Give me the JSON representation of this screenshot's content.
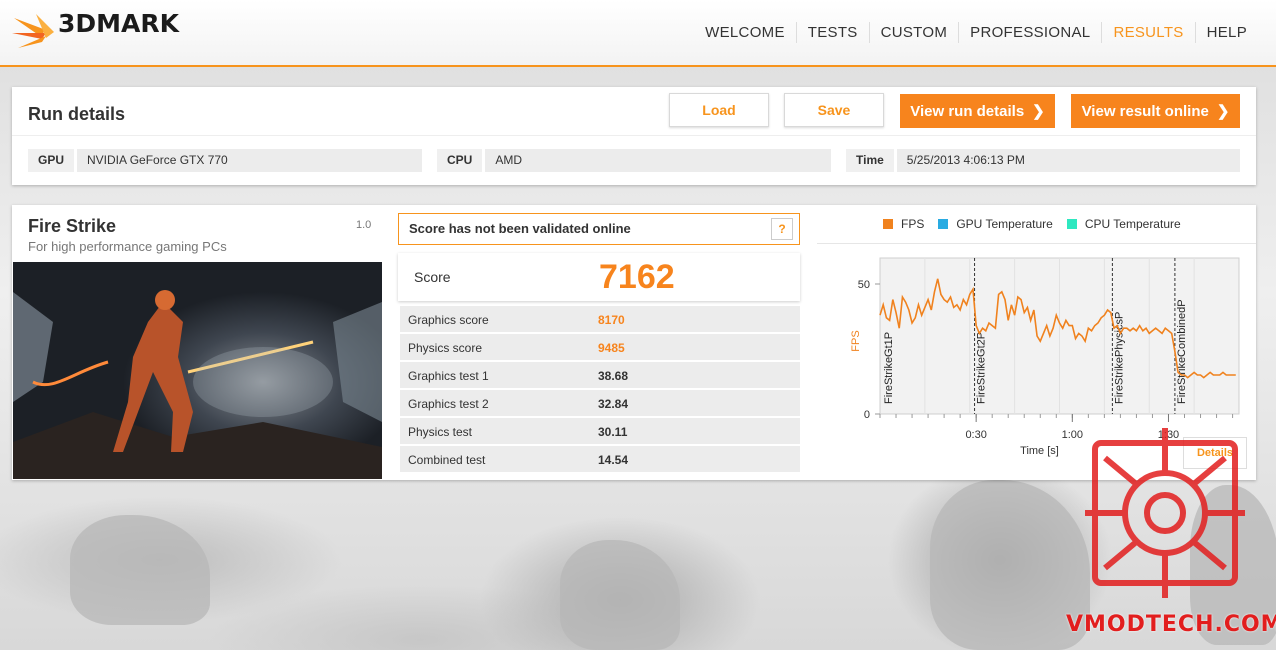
{
  "app": {
    "logo_text": "3DMARK"
  },
  "nav": {
    "items": [
      {
        "label": "WELCOME",
        "active": false
      },
      {
        "label": "TESTS",
        "active": false
      },
      {
        "label": "CUSTOM",
        "active": false
      },
      {
        "label": "PROFESSIONAL",
        "active": false
      },
      {
        "label": "RESULTS",
        "active": true
      },
      {
        "label": "HELP",
        "active": false
      }
    ]
  },
  "run_details": {
    "title": "Run details",
    "load_label": "Load",
    "save_label": "Save",
    "view_run_label": "View run details",
    "view_online_label": "View result online",
    "gpu_key": "GPU",
    "gpu_value": "NVIDIA GeForce GTX 770",
    "cpu_key": "CPU",
    "cpu_value": "AMD",
    "time_key": "Time",
    "time_value": "5/25/2013 4:06:13 PM"
  },
  "benchmark": {
    "name": "Fire Strike",
    "subtitle": "For high performance gaming PCs",
    "version": "1.0",
    "validation_text": "Score has not been validated online",
    "help_label": "?",
    "score_label": "Score",
    "score_value": "7162",
    "rows": [
      {
        "label": "Graphics score",
        "value": "8170",
        "highlight": true
      },
      {
        "label": "Physics score",
        "value": "9485",
        "highlight": true
      },
      {
        "label": "Graphics test 1",
        "value": "38.68",
        "highlight": false
      },
      {
        "label": "Graphics test 2",
        "value": "32.84",
        "highlight": false
      },
      {
        "label": "Physics test",
        "value": "30.11",
        "highlight": false
      },
      {
        "label": "Combined test",
        "value": "14.54",
        "highlight": false
      }
    ],
    "details_label": "Details"
  },
  "colors": {
    "accent": "#f7941d",
    "fps": "#f0821e",
    "gpu_temp": "#29abe2",
    "cpu_temp": "#2ee8c0"
  },
  "watermark": {
    "text": "VMODTECH.COM"
  },
  "chart_data": {
    "type": "line",
    "legend": [
      {
        "name": "FPS",
        "color": "#f0821e"
      },
      {
        "name": "GPU Temperature",
        "color": "#29abe2"
      },
      {
        "name": "CPU Temperature",
        "color": "#2ee8c0"
      }
    ],
    "ylabel": "FPS",
    "xlabel": "Time [s]",
    "ylim": [
      0,
      60
    ],
    "xlim": [
      0,
      112
    ],
    "y_ticks": [
      "0",
      "50"
    ],
    "x_ticks": [
      {
        "value": 30,
        "label": "0:30"
      },
      {
        "value": 60,
        "label": "1:00"
      },
      {
        "value": 90,
        "label": "1:30"
      }
    ],
    "markers": [
      {
        "x": 0,
        "label": "FireStrikeGt1P"
      },
      {
        "x": 29.5,
        "label": "FireStrikeGt2P"
      },
      {
        "x": 72.5,
        "label": "FireStrikePhysicsP"
      },
      {
        "x": 92,
        "label": "FireStrikeCombinedP"
      }
    ],
    "series": [
      {
        "name": "FPS",
        "x": [
          0,
          1,
          2,
          3,
          4,
          5,
          6,
          7,
          8,
          9,
          10,
          11,
          12,
          13,
          14,
          15,
          16,
          17,
          18,
          19,
          20,
          21,
          22,
          23,
          24,
          25,
          26,
          27,
          28,
          29,
          30,
          31,
          32,
          33,
          34,
          35,
          36,
          37,
          38,
          39,
          40,
          41,
          42,
          43,
          44,
          45,
          46,
          47,
          48,
          49,
          50,
          51,
          52,
          53,
          54,
          55,
          56,
          57,
          58,
          59,
          60,
          61,
          62,
          63,
          64,
          65,
          66,
          67,
          68,
          69,
          70,
          71,
          72,
          73,
          74,
          75,
          76,
          77,
          78,
          79,
          80,
          81,
          82,
          83,
          84,
          85,
          86,
          87,
          88,
          89,
          90,
          91,
          92,
          93,
          94,
          95,
          96,
          97,
          98,
          99,
          100,
          101,
          102,
          103,
          104,
          105,
          106,
          107,
          108,
          109,
          110,
          111
        ],
        "values": [
          38,
          42,
          37,
          36,
          44,
          39,
          33,
          45,
          43,
          40,
          35,
          37,
          42,
          38,
          41,
          44,
          40,
          47,
          52,
          46,
          44,
          43,
          45,
          41,
          42,
          40,
          44,
          42,
          46,
          48,
          34,
          31,
          33,
          32,
          35,
          34,
          33,
          46,
          47,
          44,
          36,
          42,
          38,
          45,
          44,
          39,
          41,
          36,
          40,
          30,
          28,
          31,
          34,
          30,
          33,
          38,
          35,
          33,
          36,
          34,
          34,
          29,
          31,
          30,
          28,
          33,
          32,
          34,
          35,
          37,
          38,
          40,
          39,
          33,
          34,
          31,
          33,
          33,
          32,
          33,
          32,
          34,
          32,
          33,
          31,
          32,
          33,
          32,
          31,
          33,
          32,
          31,
          24,
          16,
          15,
          15,
          14,
          15,
          16,
          15,
          15,
          14,
          15,
          16,
          15,
          15,
          15,
          16,
          15,
          15,
          15,
          15
        ]
      }
    ]
  }
}
